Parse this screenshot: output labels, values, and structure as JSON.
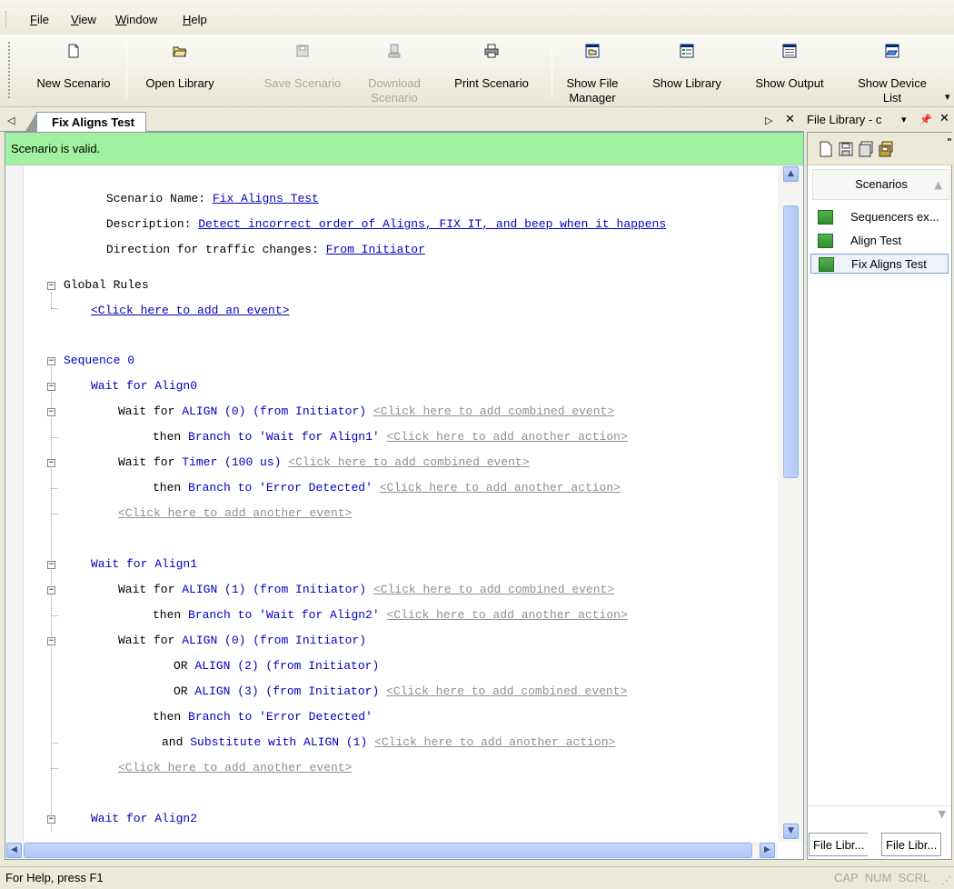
{
  "menu": {
    "items": [
      "File",
      "View",
      "Window",
      "Help"
    ]
  },
  "toolbar": {
    "buttons": [
      {
        "label": "New Scenario",
        "enabled": true
      },
      {
        "label": "Open Library",
        "enabled": true
      },
      {
        "label": "Save Scenario",
        "enabled": false
      },
      {
        "label": "Download\nScenario",
        "enabled": false
      },
      {
        "label": "Print Scenario",
        "enabled": true
      },
      {
        "label": "Show File\nManager",
        "enabled": true
      },
      {
        "label": "Show Library",
        "enabled": true
      },
      {
        "label": "Show Output",
        "enabled": true
      },
      {
        "label": "Show Device\nList",
        "enabled": true
      }
    ]
  },
  "doc": {
    "tab_title": "Fix Aligns Test",
    "status": "Scenario is valid.",
    "scenario_name_label": "Scenario Name:",
    "scenario_name": "Fix Aligns Test",
    "description_label": "Description:",
    "description": "Detect incorrect order of Aligns, FIX IT, and beep when it happens",
    "direction_label": "Direction for traffic changes:",
    "direction": "From Initiator",
    "global_rules": "Global Rules",
    "add_event": "<Click here to add an event>",
    "sequence": "Sequence 0",
    "wait0": "Wait for Align0",
    "wait_for": "Wait for",
    "then": "then",
    "branch_to": "Branch to",
    "or": "OR",
    "and": "and",
    "substitute": "Substitute with ALIGN (1)",
    "align0": "ALIGN (0) (from Initiator)",
    "align1": "ALIGN (1) (from Initiator)",
    "align2": "ALIGN (2) (from Initiator)",
    "align3": "ALIGN (3) (from Initiator)",
    "timer": "Timer (100 us)",
    "target_align1": "'Wait for Align1'",
    "target_align2": "'Wait for Align2'",
    "target_error": "'Error Detected'",
    "add_combined": "<Click here to add combined event>",
    "add_action": "<Click here to add another action>",
    "add_another_event": "<Click here to add another event>",
    "wait1": "Wait for Align1",
    "wait2": "Wait for Align2"
  },
  "panel": {
    "title": "File Library - c",
    "tab_header": "Scenarios",
    "items": [
      "Sequencers ex...",
      "Align Test",
      "Fix Aligns Test"
    ],
    "selected": "Fix Aligns Test",
    "bottom_tabs": [
      "File Libr...",
      "File Libr..."
    ]
  },
  "statusbar": {
    "help": "For Help, press F1",
    "indicators": "CAP  NUM  SCRL"
  }
}
